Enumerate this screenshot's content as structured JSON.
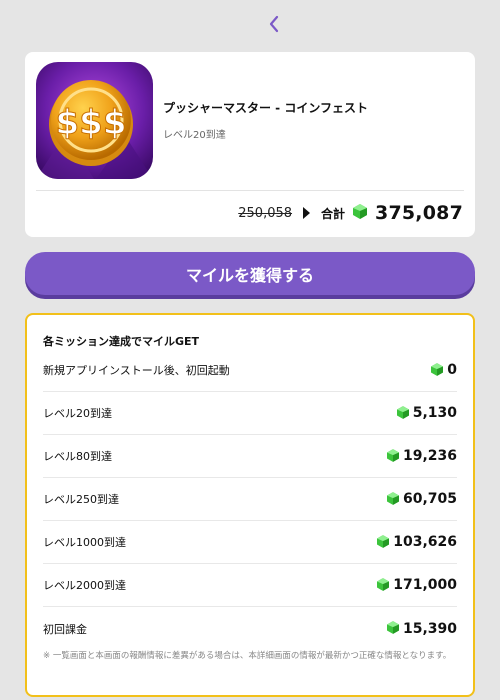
{
  "app": {
    "title": "プッシャーマスター - コインフェスト",
    "subtitle": "レベル20到達",
    "icon_name": "coin-dollar-icon"
  },
  "price": {
    "old_value": "250,058",
    "total_label": "合計",
    "total_value": "375,087"
  },
  "cta": {
    "label": "マイルを獲得する"
  },
  "missions": {
    "header": "各ミッション達成でマイルGET",
    "rows": [
      {
        "label": "新規アプリインストール後、初回起動",
        "value": "0"
      },
      {
        "label": "レベル20到達",
        "value": "5,130"
      },
      {
        "label": "レベル80到達",
        "value": "19,236"
      },
      {
        "label": "レベル250到達",
        "value": "60,705"
      },
      {
        "label": "レベル1000到達",
        "value": "103,626"
      },
      {
        "label": "レベル2000到達",
        "value": "171,000"
      },
      {
        "label": "初回課金",
        "value": "15,390"
      }
    ],
    "note": "※ 一覧画面と本画面の報酬情報に差異がある場合は、本詳細画面の情報が最新かつ正確な情報となります。"
  },
  "colors": {
    "accent": "#7b59c7",
    "mission_border": "#f2c01a",
    "gem": "#3cc43c"
  }
}
